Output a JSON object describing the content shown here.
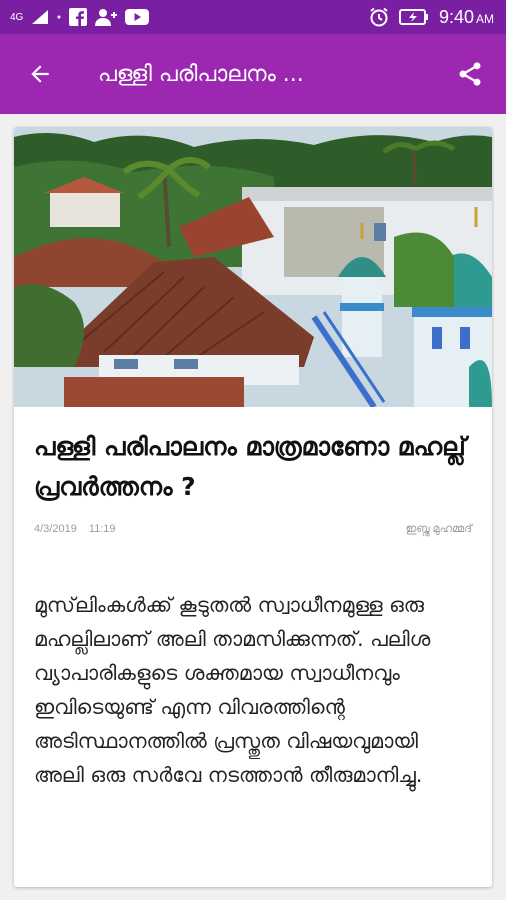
{
  "status_bar": {
    "network": "4G",
    "time": "9:40",
    "ampm": "AM",
    "icons": [
      "signal-icon",
      "facebook-icon",
      "person-add-icon",
      "youtube-icon",
      "alarm-icon",
      "battery-charging-icon"
    ]
  },
  "app_bar": {
    "title": "പള്ളി പരിപാലനം ...",
    "back_icon": "arrow-back-icon",
    "share_icon": "share-icon"
  },
  "article": {
    "title": "പള്ളി പരിപാലനം മാത്രമാണോ മഹല്ല് പ്രവർത്തനം ?",
    "date": "4/3/2019",
    "time": "11:19",
    "author": "ഇബ്നു മുഹമ്മദ്",
    "body": "മുസ്‌ലിംകൾക്ക് കൂടുതൽ സ്വാധീനമുള്ള ഒരു മഹല്ലിലാണ് അലി താമസിക്കുന്നത്. പലിശ വ്യാപാരികളുടെ ശക്തമായ സ്വാധീനവും ഇവിടെയുണ്ട് എന്ന വിവരത്തിന്റെ അടിസ്ഥാനത്തിൽ പ്രസ്തുത വിഷയവുമായി അലി ഒരു സർവേ നടത്താൻ തീരുമാനിച്ചു."
  },
  "colors": {
    "status_bar": "#7b1fa2",
    "app_bar": "#9c27b0",
    "background": "#f0f0f0",
    "card": "#ffffff"
  }
}
